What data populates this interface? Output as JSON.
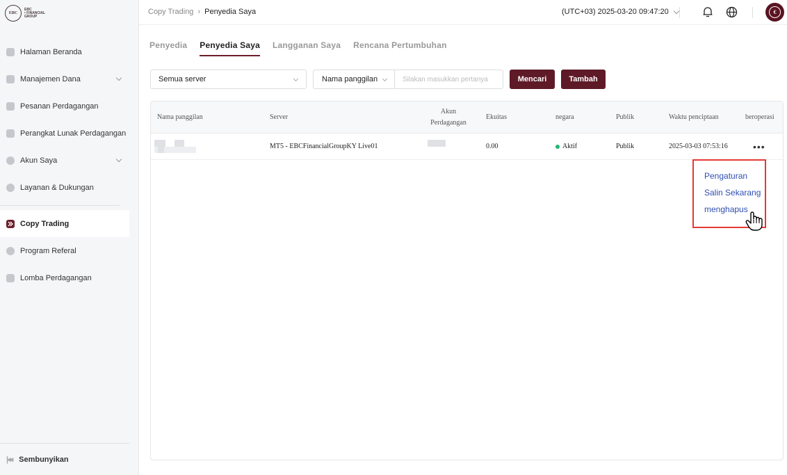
{
  "brand": {
    "logo_mark": "EBC",
    "logo_line1": "EBC",
    "logo_line2": "• FINANCIAL",
    "logo_line3": "GROUP"
  },
  "sidebar": {
    "items": [
      {
        "label": "Halaman Beranda",
        "icon": "home-icon",
        "has_chevron": false
      },
      {
        "label": "Manajemen Dana",
        "icon": "wallet-icon",
        "has_chevron": true
      },
      {
        "label": "Pesanan Perdagangan",
        "icon": "chart-icon",
        "has_chevron": false
      },
      {
        "label": "Perangkat Lunak Perdagangan",
        "icon": "cube-icon",
        "has_chevron": false
      },
      {
        "label": "Akun Saya",
        "icon": "user-icon",
        "has_chevron": true
      },
      {
        "label": "Layanan & Dukungan",
        "icon": "help-icon",
        "has_chevron": false
      }
    ],
    "active_item": {
      "label": "Copy Trading",
      "icon": "copy-trading-icon"
    },
    "items_after": [
      {
        "label": "Program Referal",
        "icon": "referral-icon"
      },
      {
        "label": "Lomba Perdagangan",
        "icon": "trophy-icon"
      }
    ],
    "collapse_label": "Sembunyikan"
  },
  "topbar": {
    "breadcrumb_root": "Copy Trading",
    "breadcrumb_current": "Penyedia Saya",
    "timezone_text": "(UTC+03)  2025-03-20 09:47:20"
  },
  "tabs": [
    "Penyedia",
    "Penyedia Saya",
    "Langganan Saya",
    "Rencana Pertumbuhan"
  ],
  "active_tab": "Penyedia Saya",
  "filters": {
    "server_select": "Semua server",
    "field_select": "Nama panggilan",
    "search_placeholder": "Silakan masukkan pertanya",
    "search_button": "Mencari",
    "add_button": "Tambah"
  },
  "table": {
    "headers": {
      "nickname": "Nama panggilan",
      "server": "Server",
      "account_line1": "Akun",
      "account_line2": "Perdagangan",
      "equity": "Ekuitas",
      "state": "negara",
      "public": "Publik",
      "created": "Waktu penciptaan",
      "ops": "beroperasi"
    },
    "rows": [
      {
        "server": "MT5 - EBCFinancialGroupKY Live01",
        "equity": "0.00",
        "state": "Aktif",
        "public": "Publik",
        "created": "2025-03-03 07:53:16",
        "ops": "•••"
      }
    ]
  },
  "dropdown_menu": [
    "Pengaturan",
    "Salin Sekarang",
    "menghapus"
  ],
  "colors": {
    "accent": "#5e1a27",
    "status_active": "#22b573",
    "menu_link": "#2f4fb3",
    "highlight_border": "#e53935"
  }
}
